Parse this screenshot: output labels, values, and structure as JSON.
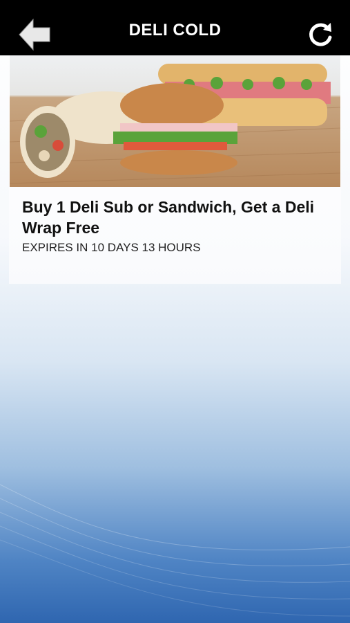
{
  "header": {
    "title": "DELI COLD",
    "back_icon": "arrow-left-icon",
    "refresh_icon": "refresh-icon"
  },
  "offer": {
    "image_alt": "Deli wrap, croissant sandwich and deli sub",
    "title": "Buy 1 Deli Sub or Sandwich, Get a Deli Wrap Free",
    "expiry": "EXPIRES IN 10 DAYS 13 HOURS"
  },
  "colors": {
    "topbar": "#000000",
    "accent_blue": "#2f66b0"
  }
}
